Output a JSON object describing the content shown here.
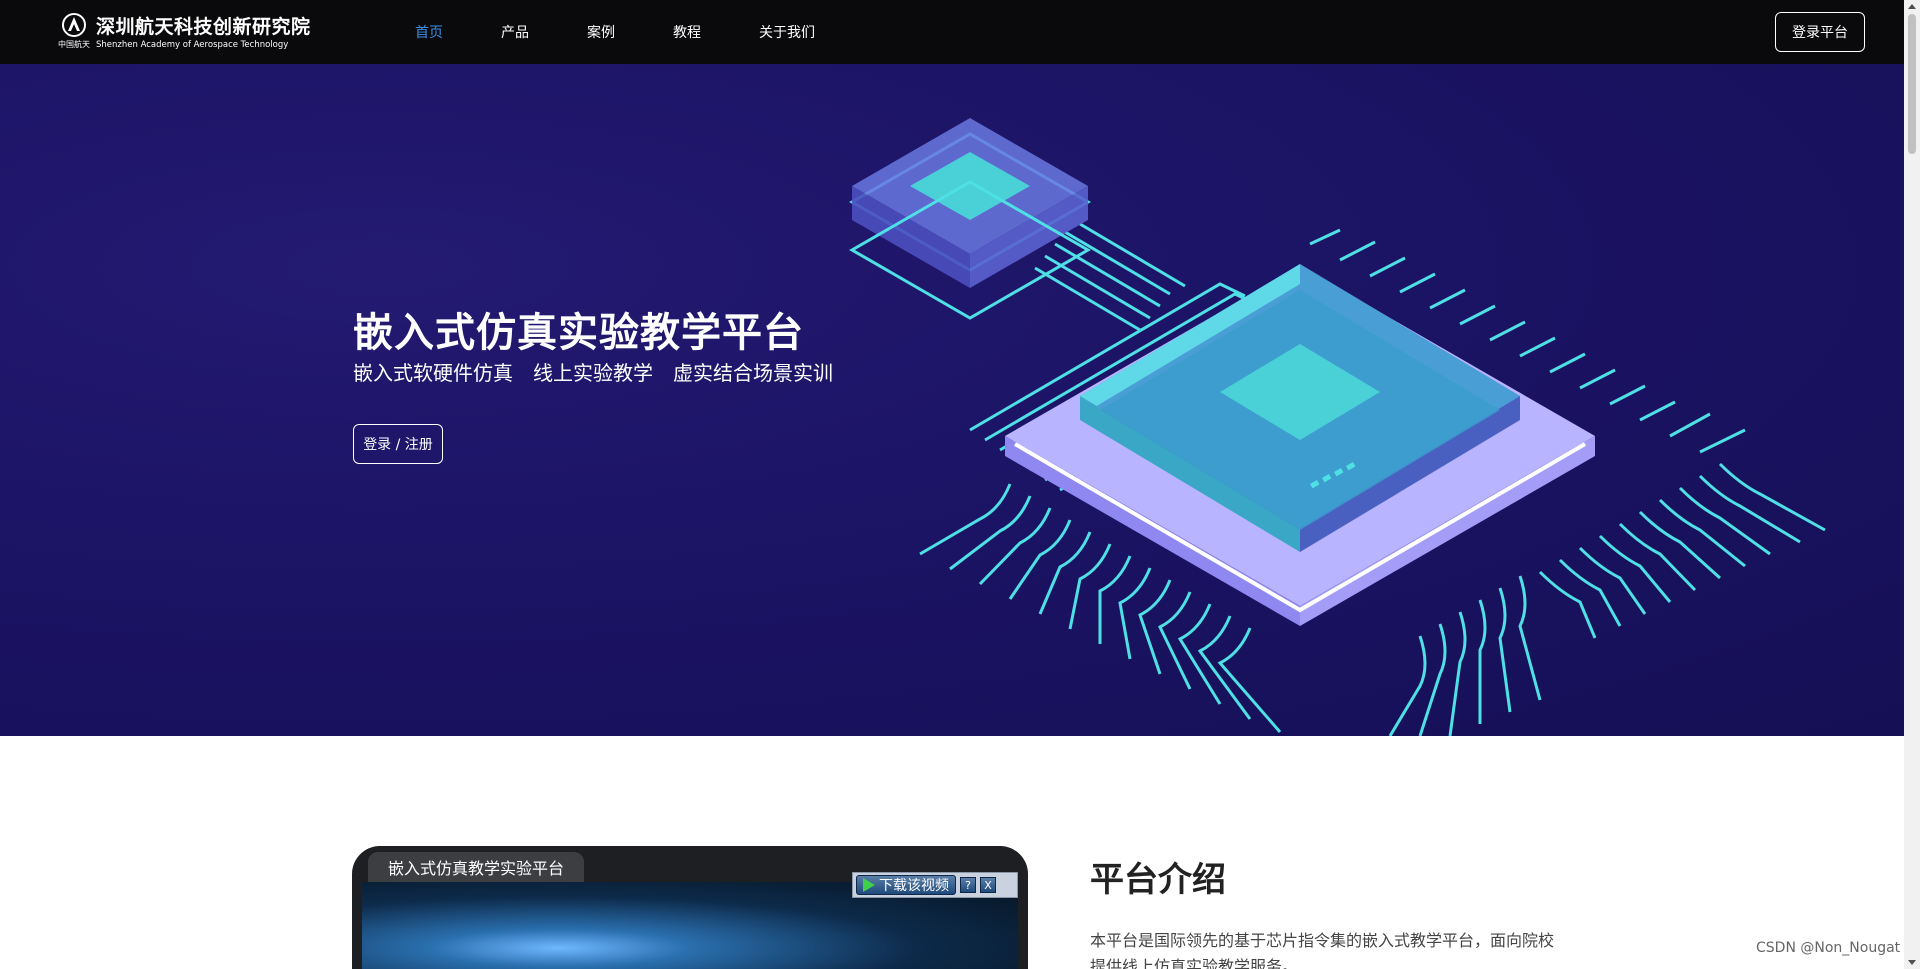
{
  "header": {
    "logo_cn": "深圳航天科技创新研究院",
    "logo_en": "Shenzhen Academy of Aerospace Technology",
    "logo_mark_text": "中国航天",
    "nav": [
      "首页",
      "产品",
      "案例",
      "教程",
      "关于我们"
    ],
    "active_nav": "首页",
    "login_label": "登录平台"
  },
  "hero": {
    "title": "嵌入式仿真实验教学平台",
    "subtitle": "嵌入式软硬件仿真　线上实验教学　虚实结合场景实训",
    "button_label": "登录 / 注册"
  },
  "video": {
    "tab_label": "嵌入式仿真教学实验平台",
    "download_label": "下载该视频",
    "help_label": "?",
    "close_label": "X"
  },
  "intro": {
    "title": "平台介绍",
    "text": "本平台是国际领先的基于芯片指令集的嵌入式教学平台，面向院校提供线上仿真实验教学服务。"
  },
  "watermark": "CSDN @Non_Nougat",
  "colors": {
    "header_bg": "#0a0a0c",
    "nav_active": "#3a8ee6",
    "hero_bg": "#1c1466",
    "chip_cyan": "#4fe0e6",
    "chip_lavender": "#b8b4ff"
  }
}
